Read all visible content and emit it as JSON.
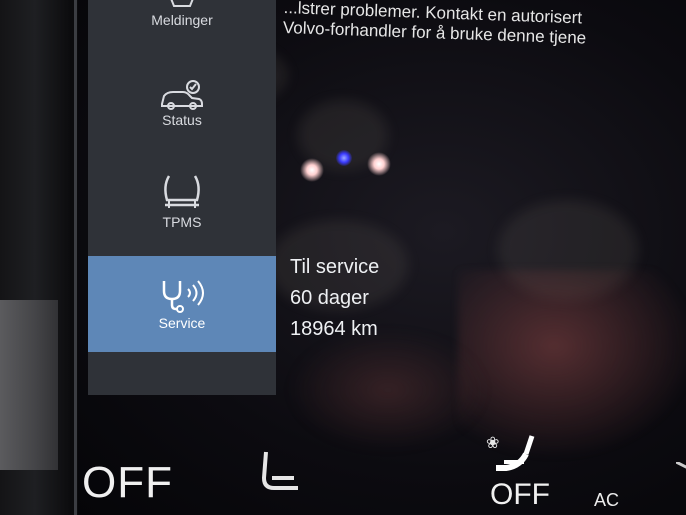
{
  "notice": {
    "line1": "...lstrer problemer. Kontakt en autorisert",
    "line2": "Volvo-forhandler for å bruke denne tjene"
  },
  "sidebar": {
    "items": [
      {
        "label": "Meldinger",
        "icon": "messages-icon"
      },
      {
        "label": "Status",
        "icon": "car-check-icon"
      },
      {
        "label": "TPMS",
        "icon": "tire-pressure-icon"
      },
      {
        "label": "Service",
        "icon": "service-wrench-icon",
        "active": true
      }
    ]
  },
  "service": {
    "title": "Til service",
    "days": "60 dager",
    "distance": "18964 km"
  },
  "climate": {
    "left_off": "OFF",
    "right_off": "OFF",
    "ac": "AC"
  },
  "colors": {
    "sidebar_bg": "#2f3238",
    "active_item": "#5e87b7",
    "text": "#eef0f3"
  }
}
